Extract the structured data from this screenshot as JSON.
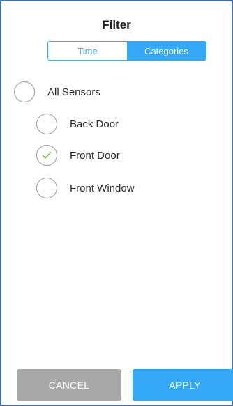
{
  "header": {
    "title": "Filter"
  },
  "tabs": [
    {
      "label": "Time",
      "selected": false
    },
    {
      "label": "Categories",
      "selected": true
    }
  ],
  "options": [
    {
      "label": "All Sensors",
      "checked": false
    },
    {
      "label": "Back Door",
      "checked": false
    },
    {
      "label": "Front Door",
      "checked": true
    },
    {
      "label": "Front Window",
      "checked": false
    }
  ],
  "footer": {
    "cancel_label": "CANCEL",
    "apply_label": "APPLY"
  },
  "colors": {
    "accent": "#34a8f5",
    "check": "#7cc242",
    "cancel": "#a8a8a8",
    "frame": "#3c6fb0"
  }
}
